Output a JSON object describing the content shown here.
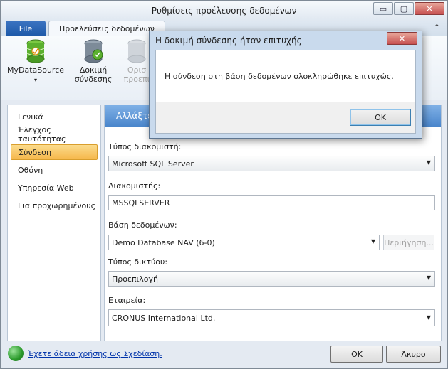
{
  "window": {
    "title": "Ρυθμίσεις προέλευσης δεδομένων",
    "controls": {
      "minimize": "▭",
      "maximize": "▢",
      "close": "✕"
    }
  },
  "ribbon": {
    "file_tab": "File",
    "active_tab": "Προελεύσεις δεδομένων",
    "collapse_icon": "⌃",
    "buttons": [
      {
        "label": "MyDataSource",
        "icon": "database-icon",
        "dropdown": "▾"
      },
      {
        "label_line1": "Δοκιμή",
        "label_line2": "σύνδεσης",
        "icon": "database-test-icon"
      },
      {
        "label_line1": "Ορισ",
        "label_line2": "προεπι",
        "icon": "database-default-icon",
        "disabled": true
      }
    ]
  },
  "nav": {
    "items": [
      "Γενικά",
      "Έλεγχος ταυτότητας",
      "Σύνδεση",
      "Οθόνη",
      "Υπηρεσία Web",
      "Για προχωρημένους"
    ],
    "selected": "Σύνδεση"
  },
  "content": {
    "header": "Αλλάξτε",
    "server_type": {
      "label": "Τύπος διακομιστή:",
      "value": "Microsoft SQL Server"
    },
    "server": {
      "label": "Διακομιστής:",
      "value": "MSSQLSERVER"
    },
    "database": {
      "label": "Βάση δεδομένων:",
      "value": "Demo Database NAV (6-0)",
      "browse_label": "Περιήγηση..."
    },
    "network_type": {
      "label": "Τύπος δικτύου:",
      "value": "Προεπιλογή"
    },
    "company": {
      "label": "Εταιρεία:",
      "value": "CRONUS International Ltd."
    },
    "dropdown_arrow": "▼"
  },
  "footer": {
    "license_text": "Έχετε άδεια χρήσης ως Σχεδίαση.",
    "ok_label": "OK",
    "cancel_label": "Άκυρο"
  },
  "dialog": {
    "title": "Η δοκιμή σύνδεσης ήταν επιτυχής",
    "message": "Η σύνδεση στη βάση δεδομένων ολοκληρώθηκε επιτυχώς.",
    "ok_label": "OK",
    "close": "✕"
  },
  "colors": {
    "accent": "#4a86cc",
    "selection": "#f6b74b",
    "link": "#0033aa"
  }
}
